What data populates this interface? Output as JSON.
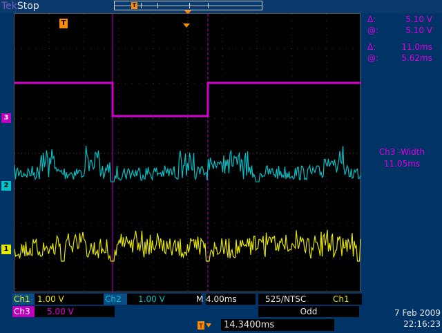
{
  "header": {
    "brand_a": "Tek",
    "brand_b": "Stop",
    "trigger_marker": "T"
  },
  "levels": {
    "ch3": "3",
    "ch2": "2",
    "ch1": "1"
  },
  "cursor_readout": {
    "dv_sym": "Δ:",
    "dv_val": "5.10 V",
    "av_sym": "@:",
    "av_val": "5.10 V",
    "dt_sym": "Δ:",
    "dt_val": "11.0ms",
    "at_sym": "@:",
    "at_val": "5.62ms"
  },
  "measurement": {
    "label": "Ch3 -Width",
    "value": "11.05ms"
  },
  "channels": {
    "ch1_label": "Ch1",
    "ch1_scale": "1.00 V",
    "ch2_label": "Ch2",
    "ch2_scale": "1.00 V",
    "ch3_label": "Ch3",
    "ch3_scale": "5.00 V"
  },
  "timebase": {
    "label": "M",
    "value": "4.00ms"
  },
  "trigger": {
    "standard": "525/NTSC",
    "source": "Ch1",
    "mode": "Odd",
    "position": "14.3400ms"
  },
  "datetime": {
    "date": "7 Feb  2009",
    "time": "22:16:23"
  },
  "colors": {
    "ch1": "#e6e600",
    "ch2": "#00c0c8",
    "ch3": "#d000d0",
    "trigger": "#ff8a00"
  }
}
